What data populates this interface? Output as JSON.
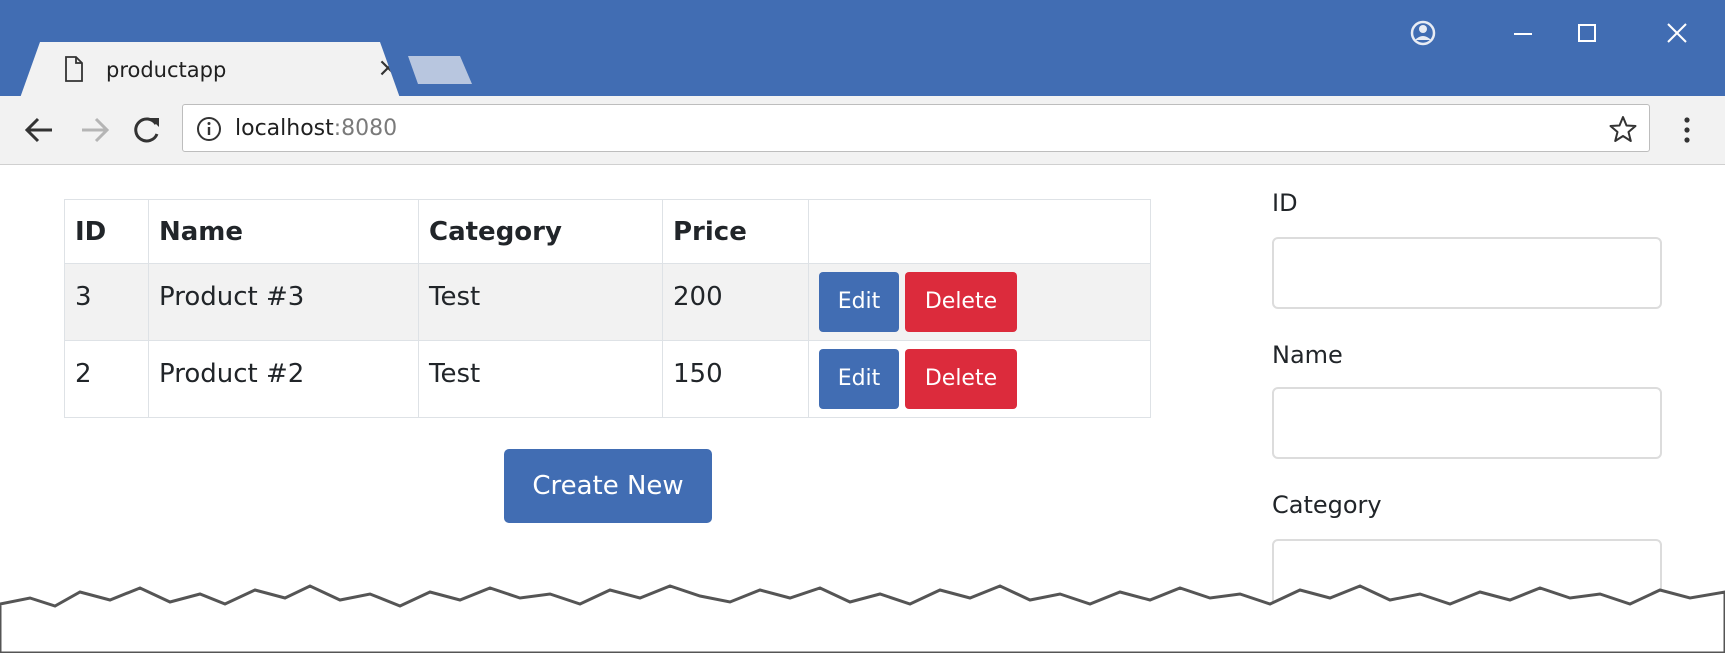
{
  "browser": {
    "tab_title": "productapp",
    "url_host": "localhost",
    "url_port": ":8080"
  },
  "table": {
    "headers": [
      "ID",
      "Name",
      "Category",
      "Price",
      ""
    ],
    "rows": [
      {
        "id": "3",
        "name": "Product #3",
        "category": "Test",
        "price": "200"
      },
      {
        "id": "2",
        "name": "Product #2",
        "category": "Test",
        "price": "150"
      }
    ],
    "edit_label": "Edit",
    "delete_label": "Delete"
  },
  "create_label": "Create New",
  "form": {
    "id_label": "ID",
    "name_label": "Name",
    "category_label": "Category"
  },
  "colors": {
    "primary": "#416db3",
    "danger": "#dc2b3c",
    "titlebar": "#416db3"
  }
}
